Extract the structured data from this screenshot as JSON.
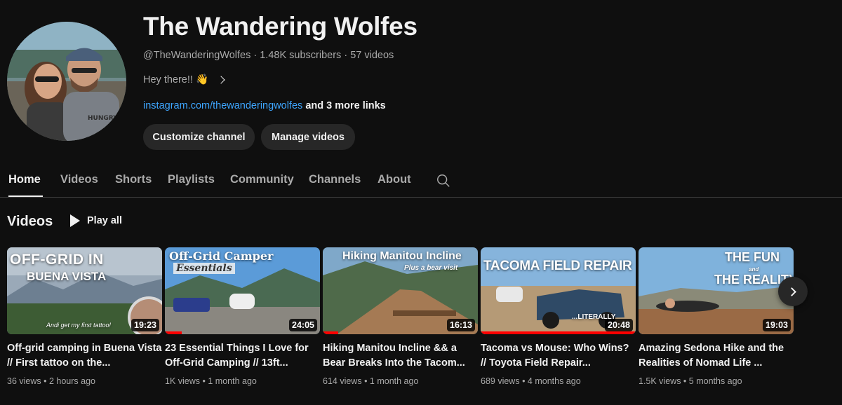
{
  "channel": {
    "name": "The Wandering Wolfes",
    "handle": "@TheWanderingWolfes",
    "subscribers": "1.48K subscribers",
    "videos_count": "57 videos",
    "description": "Hey there!! 👋",
    "link_text": "instagram.com/thewanderingwolfes",
    "more_links": "and 3 more links",
    "customize_label": "Customize channel",
    "manage_label": "Manage videos"
  },
  "tabs": [
    "Home",
    "Videos",
    "Shorts",
    "Playlists",
    "Community",
    "Channels",
    "About"
  ],
  "section": {
    "title": "Videos",
    "play_all": "Play all"
  },
  "videos": [
    {
      "title": "Off-grid camping in Buena Vista // First tattoo on the...",
      "views": "36 views",
      "age": "2 hours ago",
      "duration": "19:23",
      "thumb_line1": "OFF-GRID IN",
      "thumb_line2": "BUENA VISTA",
      "thumb_caption": "Andi get my first tattoo!",
      "progress": 0
    },
    {
      "title": "23 Essential Things I Love for Off-Grid Camping // 13ft...",
      "views": "1K views",
      "age": "1 month ago",
      "duration": "24:05",
      "thumb_line1": "Off-Grid Camper",
      "thumb_line2": "Essentials",
      "progress": 0.11
    },
    {
      "title": "Hiking Manitou Incline && a Bear Breaks Into the Tacom...",
      "views": "614 views",
      "age": "1 month ago",
      "duration": "16:13",
      "thumb_line1": "Hiking Manitou Incline",
      "thumb_line2": "Plus a bear visit",
      "progress": 0.1
    },
    {
      "title": "Tacoma vs Mouse: Who Wins? // Toyota Field Repair...",
      "views": "689 views",
      "age": "4 months ago",
      "duration": "20:48",
      "thumb_line1": "TACOMA FIELD REPAIR",
      "thumb_line2": "...LITERALLY",
      "progress": 1
    },
    {
      "title": "Amazing Sedona Hike and the Realities of Nomad Life ...",
      "views": "1.5K views",
      "age": "5 months ago",
      "duration": "19:03",
      "thumb_line1": "THE FUN",
      "thumb_line2": "and",
      "thumb_line3": "THE REALITY",
      "progress": 0
    }
  ],
  "icons": {
    "search": "search-icon",
    "next": "chevron-right-icon",
    "play": "play-icon"
  }
}
